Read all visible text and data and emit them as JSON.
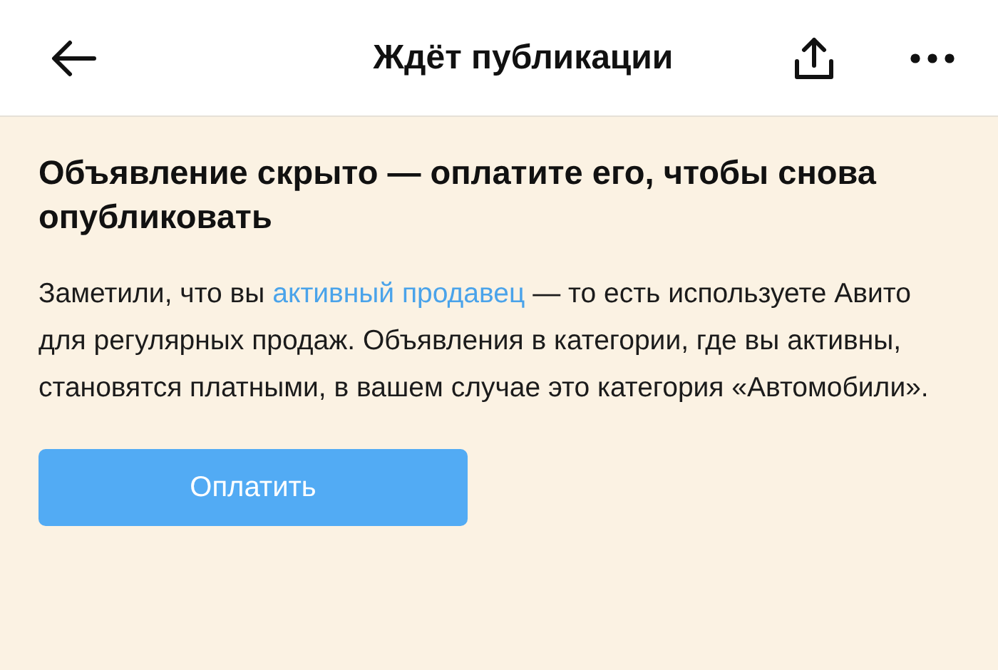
{
  "header": {
    "title": "Ждёт публикации"
  },
  "notice": {
    "heading": "Объявление скрыто — оплатите его, чтобы снова опубликовать",
    "text_before": "Заметили, что вы",
    "link": "активный продавец",
    "text_after": "— то есть используете Авито для регулярных продаж. Объявления в категории, где вы активны, становятся платными, в вашем случае это категория «Автомобили».",
    "button": "Оплатить"
  }
}
